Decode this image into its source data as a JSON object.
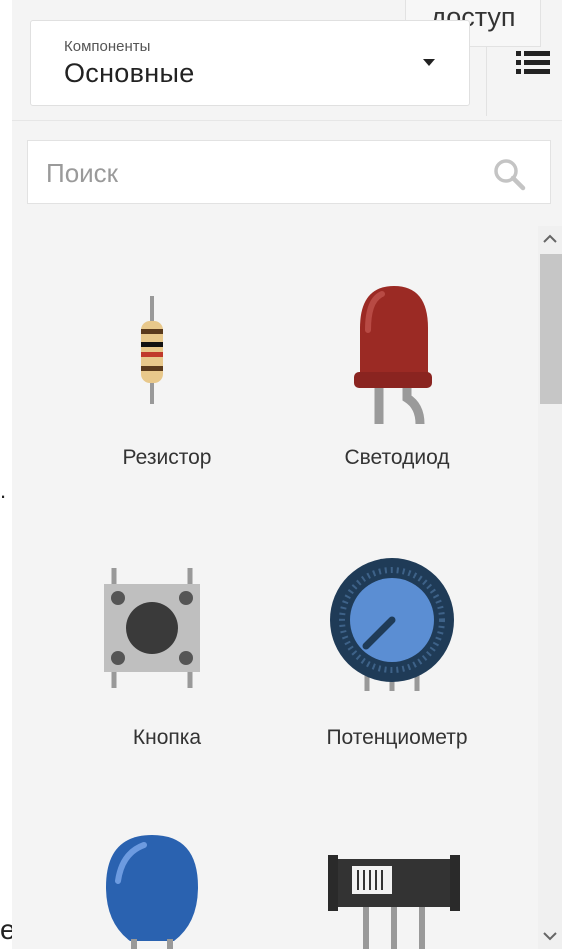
{
  "header": {
    "access_tab_label": "доступ",
    "selector_caption": "Компоненты",
    "selector_value": "Основные"
  },
  "search": {
    "placeholder": "Поиск",
    "value": ""
  },
  "components": [
    {
      "label": "Резистор",
      "icon": "resistor-icon"
    },
    {
      "label": "Светодиод",
      "icon": "led-icon"
    },
    {
      "label": "Кнопка",
      "icon": "pushbutton-icon"
    },
    {
      "label": "Потенциометр",
      "icon": "potentiometer-icon"
    },
    {
      "label": "",
      "icon": "piezo-icon"
    },
    {
      "label": "",
      "icon": "slide-switch-icon"
    }
  ],
  "stray_text": {
    "left_dot": ".",
    "left_bottom": "e-"
  },
  "colors": {
    "panel_bg": "#f4f4f4",
    "led_red": "#9b2a24",
    "pot_dark": "#1f3b57",
    "pot_knob": "#5b8ed3",
    "piezo_blue": "#2a62b0",
    "switch_dark": "#333333"
  }
}
